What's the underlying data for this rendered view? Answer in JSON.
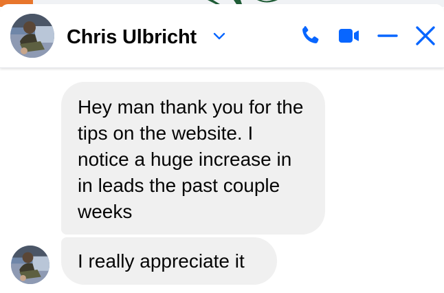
{
  "colors": {
    "accent": "#0866ff",
    "bubble_bg": "#f0f0f0",
    "text": "#050505",
    "background": "#ffffff"
  },
  "header": {
    "contact_name": "Chris Ulbricht",
    "icons": {
      "dropdown": "chevron-down-icon",
      "call": "phone-icon",
      "video": "video-camera-icon",
      "minimize": "minimize-icon",
      "close": "close-icon"
    }
  },
  "messages": [
    {
      "text": "Hey man thank you for the tips on the website. I notice a huge increase in in leads the past couple weeks"
    },
    {
      "text": "I really appreciate it"
    }
  ]
}
